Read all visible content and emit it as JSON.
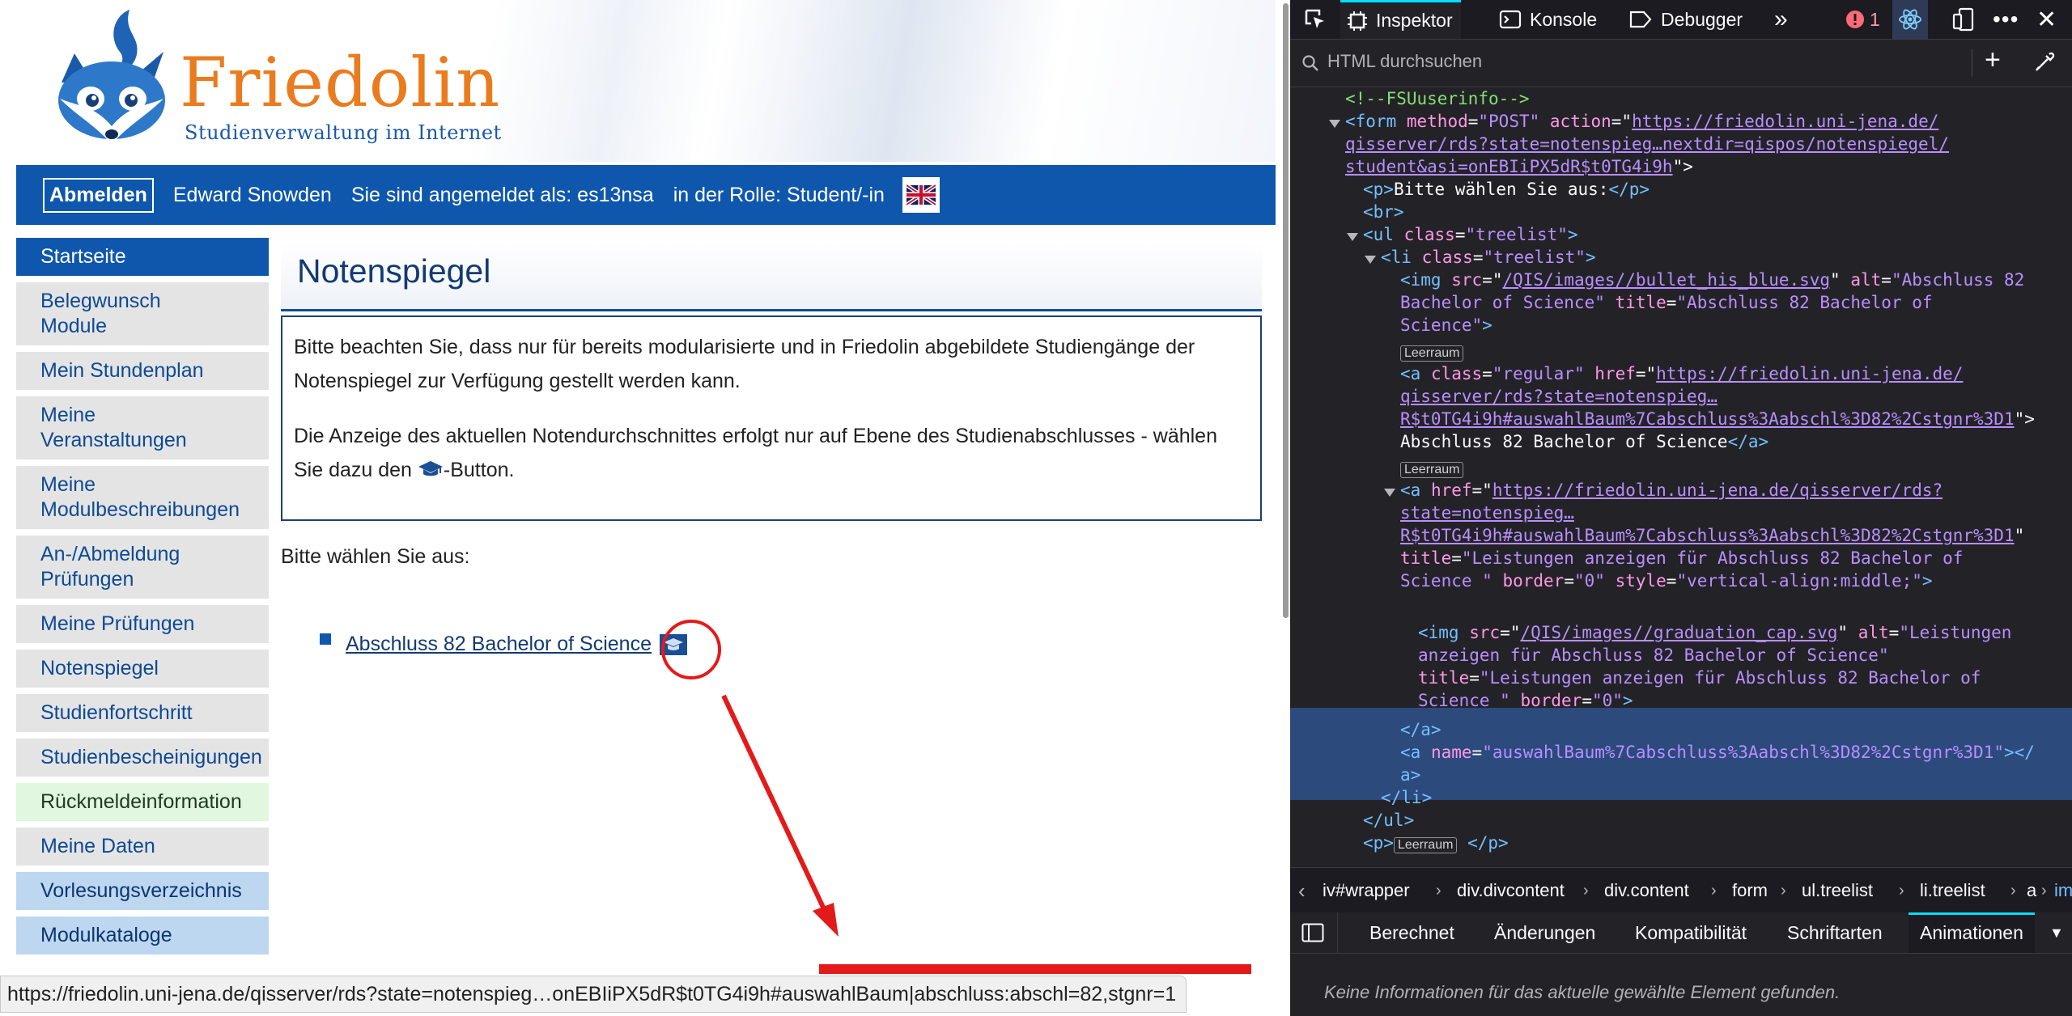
{
  "site": {
    "logo_text": "Friedolin",
    "logo_subtitle": "Studienverwaltung im Internet"
  },
  "userbar": {
    "logout_label": "Abmelden",
    "user_name": "Edward Snowden",
    "login_info": "Sie sind angemeldet als: es13nsa",
    "role_info": "in der Rolle: Student/-in",
    "flag_icon": "uk-flag-icon"
  },
  "sidebar": {
    "items": [
      {
        "label": "Startseite"
      },
      {
        "label": "Belegwunsch\nModule"
      },
      {
        "label": "Mein Stundenplan"
      },
      {
        "label": "Meine\nVeranstaltungen"
      },
      {
        "label": "Meine\nModulbeschreibungen"
      },
      {
        "label": "An-/Abmeldung\nPrüfungen"
      },
      {
        "label": "Meine Prüfungen"
      },
      {
        "label": "Notenspiegel"
      },
      {
        "label": "Studienfortschritt"
      },
      {
        "label": "Studienbescheinigungen"
      },
      {
        "label": "Rückmeldeinformation"
      },
      {
        "label": "Meine Daten"
      },
      {
        "label": "Vorlesungsverzeichnis"
      },
      {
        "label": "Modulkataloge"
      }
    ]
  },
  "main": {
    "title": "Notenspiegel",
    "notice_p1": "Bitte beachten Sie, dass nur für bereits modularisierte und in Friedolin abgebildete Studiengänge der Notenspiegel zur Verfügung gestellt werden kann.",
    "notice_p2a": "Die Anzeige des aktuellen Notendurchschnittes erfolgt nur auf Ebene des Studienabschlusses - wählen Sie dazu den ",
    "notice_p2b": "-Button.",
    "choose_label": "Bitte wählen Sie aus:",
    "degree_link": "Abschluss 82 Bachelor of Science"
  },
  "status_bar": {
    "url": "https://friedolin.uni-jena.de/qisserver/rds?state=notenspieg…onEBIiPX5dR$t0TG4i9h#auswahlBaum|abschluss:abschl=82,stgnr=1"
  },
  "annotation_colors": {
    "highlight": "#e41a1a"
  },
  "devtools": {
    "tabs": {
      "inspector": "Inspektor",
      "console": "Konsole",
      "debugger": "Debugger",
      "error_count": "1"
    },
    "search_placeholder": "HTML durchsuchen",
    "tree": {
      "comment": "<!--FSUuserinfo-->",
      "form_action_1": "https://friedolin.uni-jena.de/",
      "form_action_2": "qisserver/rds?state=notenspieg…nextdir=qispos/notenspiegel/",
      "form_action_3": "student&asi=onEBIiPX5dR$t0TG4i9h",
      "p_text": "Bitte wählen Sie aus:",
      "ul_class": "\"treelist\"",
      "li_class": "\"treelist\"",
      "img1_src": "/QIS/images//bullet_his_blue.svg",
      "img1_alt_1": "\"Abschluss 82",
      "img1_alt_2": "Bachelor of Science\"",
      "img1_title_1": "\"Abschluss 82 Bachelor of",
      "img1_title_2": "Science\"",
      "empty_badge": "Leerraum",
      "a1_href_1": "https://friedolin.uni-jena.de/",
      "a1_href_2": "qisserver/rds?state=notenspieg…",
      "a1_href_3": "R$t0TG4i9h#auswahlBaum%7Cabschluss%3Aabschl%3D82%2Cstgnr%3D1",
      "a1_text": "Abschluss 82 Bachelor of Science",
      "a2_href_1": "https://friedolin.uni-jena.de/qisserver/rds?",
      "a2_href_2": "state=notenspieg…",
      "a2_href_3": "R$t0TG4i9h#auswahlBaum%7Cabschluss%3Aabschl%3D82%2Cstgnr%3D1",
      "a2_title_1": "\"Leistungen anzeigen für Abschluss 82 Bachelor of",
      "a2_title_2": "Science \"",
      "a2_rest": "\"0\"",
      "a2_style": "\"vertical-align:middle;\"",
      "img2_src": "/QIS/images//graduation_cap.svg",
      "img2_alt_1": "\"Leistungen",
      "img2_alt_2": "anzeigen für Abschluss 82 Bachelor of Science\"",
      "img2_title_1": "\"Leistungen anzeigen für Abschluss 82 Bachelor of",
      "img2_title_2": "Science \"",
      "img2_border": "\"0\"",
      "a3_name": "\"auswahlBaum%7Cabschluss%3Aabschl%3D82%2Cstgnr%3D1\""
    },
    "breadcrumb": [
      "iv#wrapper",
      "div.divcontent",
      "div.content",
      "form",
      "ul.treelist",
      "li.treelist",
      "a",
      "img"
    ],
    "panel_tabs": [
      "Berechnet",
      "Änderungen",
      "Kompatibilität",
      "Schriftarten",
      "Animationen"
    ],
    "empty_message": "Keine Informationen für das aktuelle gewählte Element gefunden."
  }
}
